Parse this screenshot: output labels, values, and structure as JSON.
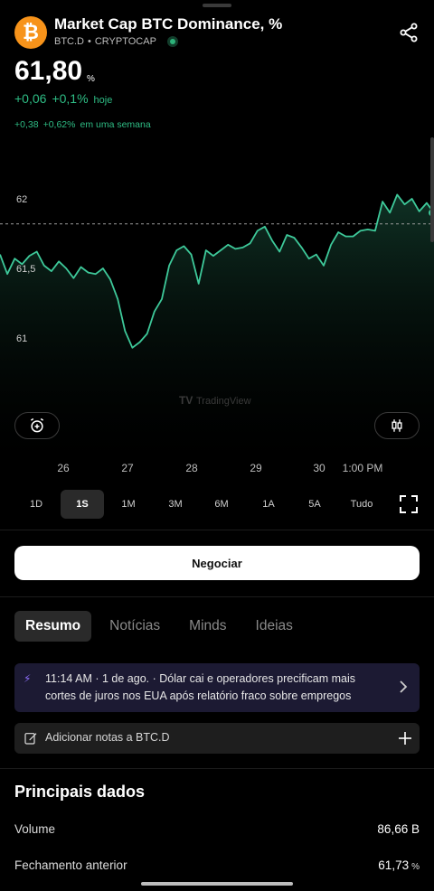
{
  "header": {
    "coin_symbol": "₿",
    "title": "Market Cap BTC Dominance, %",
    "ticker": "BTC.D",
    "separator": "•",
    "exchange": "CRYPTOCAP",
    "share_icon": "share-icon"
  },
  "quote": {
    "price": "61,80",
    "unit": "%",
    "change_abs": "+0,06",
    "change_pct": "+0,1%",
    "change_period": "hoje",
    "week_abs": "+0,38",
    "week_pct": "+0,62%",
    "week_period": "em uma semana"
  },
  "chart_data": {
    "type": "area",
    "y_ticks": [
      "62",
      "61,5",
      "61"
    ],
    "x_ticks": [
      "26",
      "27",
      "28",
      "29",
      "30",
      "1:00 PM"
    ],
    "current_level": 61.82,
    "watermark": "TradingView",
    "line_color": "#3ec99a",
    "points": [
      61.6,
      61.46,
      61.57,
      61.53,
      61.59,
      61.62,
      61.52,
      61.48,
      61.55,
      61.5,
      61.43,
      61.51,
      61.47,
      61.46,
      61.5,
      61.42,
      61.28,
      61.05,
      60.93,
      60.97,
      61.03,
      61.19,
      61.28,
      61.52,
      61.63,
      61.66,
      61.6,
      61.39,
      61.63,
      61.59,
      61.63,
      61.67,
      61.64,
      61.65,
      61.68,
      61.77,
      61.8,
      61.7,
      61.62,
      61.74,
      61.72,
      61.65,
      61.57,
      61.6,
      61.52,
      61.67,
      61.76,
      61.73,
      61.73,
      61.77,
      61.78,
      61.77,
      61.98,
      61.9,
      62.03,
      61.96,
      62.0,
      61.91,
      61.97,
      61.9
    ]
  },
  "controls": {
    "alert_icon": "alarm-plus-icon",
    "candle_icon": "candlestick-icon",
    "ranges": [
      "1D",
      "1S",
      "1M",
      "3M",
      "6M",
      "1A",
      "5A",
      "Tudo"
    ],
    "active_range": "1S",
    "fullscreen_icon": "fullscreen-icon"
  },
  "trade_button": "Negociar",
  "tabs": [
    "Resumo",
    "Notícias",
    "Minds",
    "Ideias"
  ],
  "active_tab": "Resumo",
  "news": {
    "icon": "lightning-icon",
    "text": "11:14 AM · 1 de ago. · Dólar cai e operadores precificam mais cortes de juros nos EUA após relatório fraco sobre empregos"
  },
  "notes": {
    "label": "Adicionar notas a BTC.D",
    "icon": "edit-note-icon",
    "plus_icon": "plus-icon"
  },
  "key_data": {
    "title": "Principais dados",
    "rows": [
      {
        "label": "Volume",
        "value": "86,66",
        "unit": "B"
      },
      {
        "label": "Fechamento anterior",
        "value": "61,73",
        "unit": "%"
      }
    ]
  }
}
